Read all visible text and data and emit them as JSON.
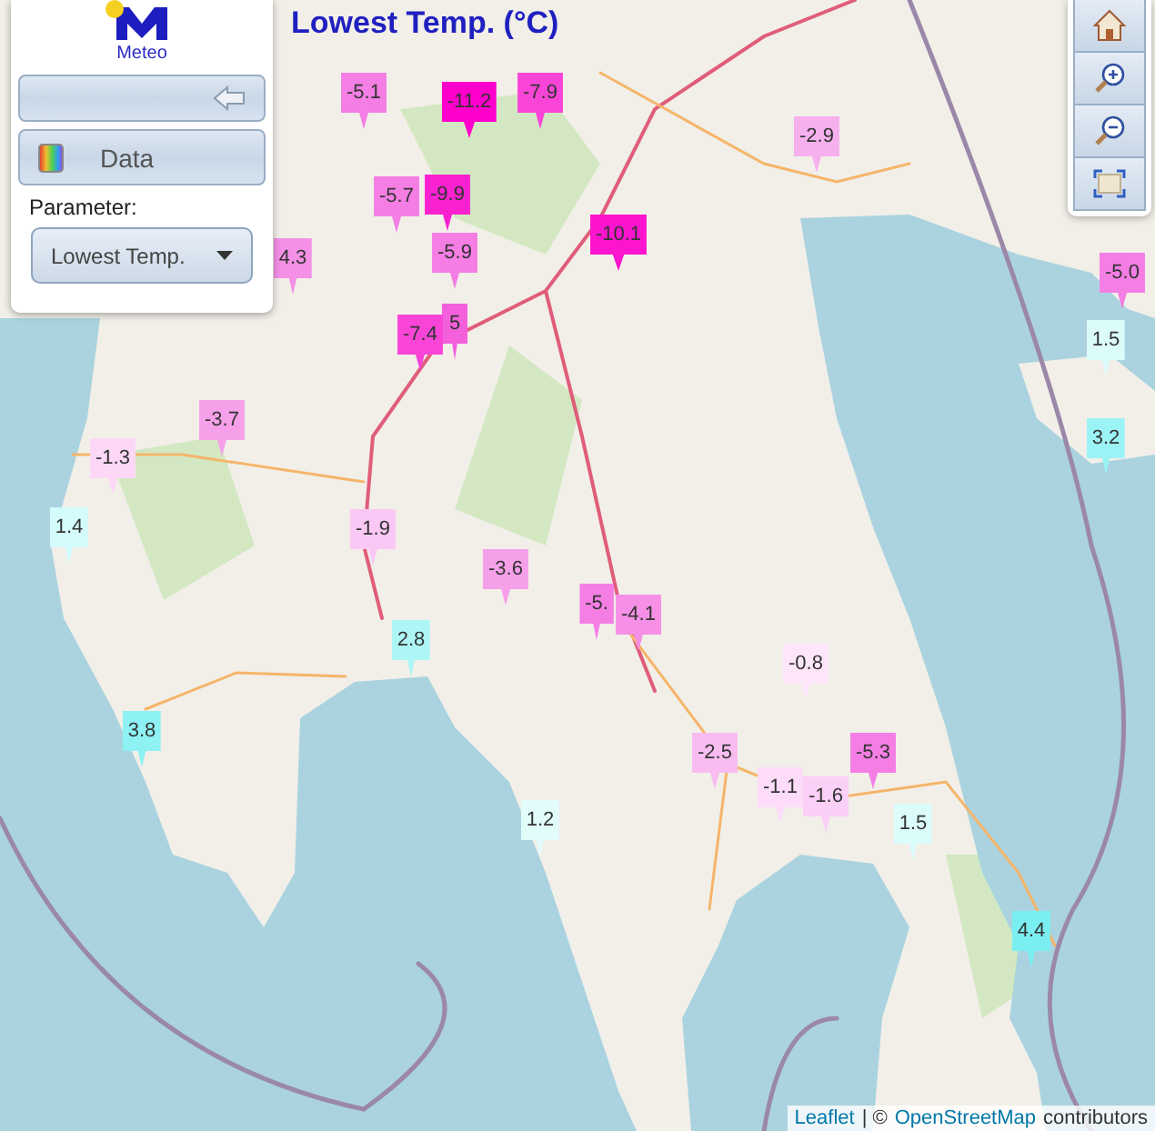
{
  "logo": {
    "text": "Meteo"
  },
  "map_title": "Lowest Temp. (°C)",
  "panel": {
    "data_button": "Data",
    "parameter_label": "Parameter:",
    "parameter_select": "Lowest Temp."
  },
  "markers": [
    {
      "value": "-5.1",
      "color": "#f47ee4"
    },
    {
      "value": "-11.2",
      "color": "#ff00cc"
    },
    {
      "value": "-7.9",
      "color": "#f845d8"
    },
    {
      "value": "-2.9",
      "color": "#f6b0ee"
    },
    {
      "value": "-5.7",
      "color": "#f47ee4"
    },
    {
      "value": "-9.9",
      "color": "#fa22d0"
    },
    {
      "value": "-5.9",
      "color": "#f47ee4"
    },
    {
      "value": "-10.1",
      "color": "#fc14ce"
    },
    {
      "value": "4.3",
      "color": "#f490e6"
    },
    {
      "value": "5",
      "color": "#f460dc"
    },
    {
      "value": "-7.4",
      "color": "#f845d8"
    },
    {
      "value": "-3.7",
      "color": "#f6a0ea"
    },
    {
      "value": "-1.3",
      "color": "#fcd8f6"
    },
    {
      "value": "1.4",
      "color": "#d4fbfb"
    },
    {
      "value": "-1.9",
      "color": "#fac8f4"
    },
    {
      "value": "-3.6",
      "color": "#f6a0ea"
    },
    {
      "value": "-5.",
      "color": "#f47ee4"
    },
    {
      "value": "-4.1",
      "color": "#f590e6"
    },
    {
      "value": "2.8",
      "color": "#aef5f6"
    },
    {
      "value": "-0.8",
      "color": "#fde6fa"
    },
    {
      "value": "3.8",
      "color": "#8ef1f3"
    },
    {
      "value": "-2.5",
      "color": "#f8bcf0"
    },
    {
      "value": "-1.1",
      "color": "#fcdcf8"
    },
    {
      "value": "-1.6",
      "color": "#fbd0f6"
    },
    {
      "value": "-5.3",
      "color": "#f47ee4"
    },
    {
      "value": "1.5",
      "color": "#dcfcfc"
    },
    {
      "value": "1.2",
      "color": "#e2fcfc"
    },
    {
      "value": "4.4",
      "color": "#7aeff1"
    },
    {
      "value": "-5.0",
      "color": "#f47ee4"
    },
    {
      "value": "1.5",
      "color": "#dcfcfc"
    },
    {
      "value": "3.2",
      "color": "#9cf3f5"
    }
  ],
  "attribution": {
    "leaflet_link": "Leaflet",
    "separator": "| ©",
    "osm_link": "OpenStreetMap",
    "suffix": "contributors"
  }
}
